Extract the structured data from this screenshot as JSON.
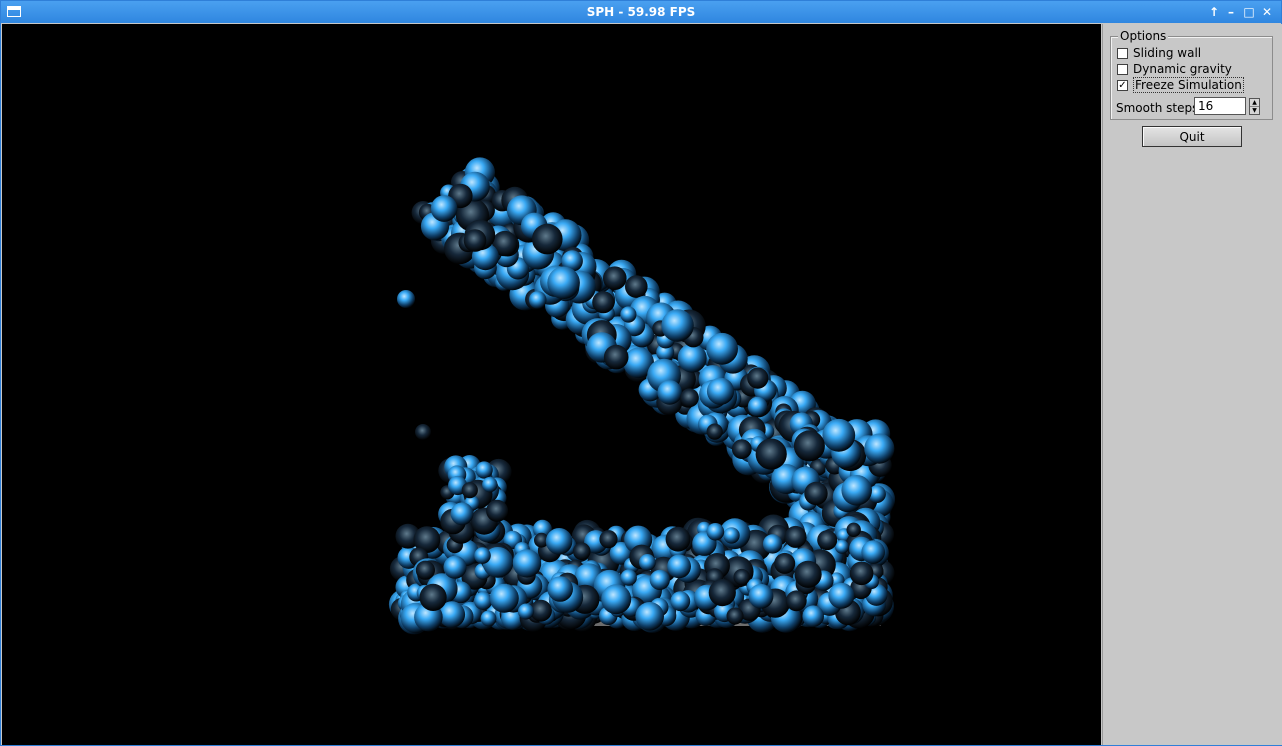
{
  "window": {
    "title": "SPH - 59.98 FPS",
    "controls": [
      "up-arrow-icon",
      "minimize-icon",
      "maximize-icon",
      "close-icon"
    ]
  },
  "options": {
    "group_title": "Options",
    "checkboxes": [
      {
        "label": "Sliding wall",
        "checked": false
      },
      {
        "label": "Dynamic gravity",
        "checked": false
      },
      {
        "label": "Freeze Simulation",
        "checked": true
      }
    ],
    "smooth_steps": {
      "label": "Smooth steps",
      "value": "16"
    }
  },
  "quit_label": "Quit",
  "colors": {
    "titlebar": "#3a8ee6",
    "panel": "#c8c8c8",
    "viewport": "#000000",
    "particle_light": "#41b4ff",
    "particle_mid": "#1a6fb8",
    "particle_dark": "#0a1e30"
  }
}
